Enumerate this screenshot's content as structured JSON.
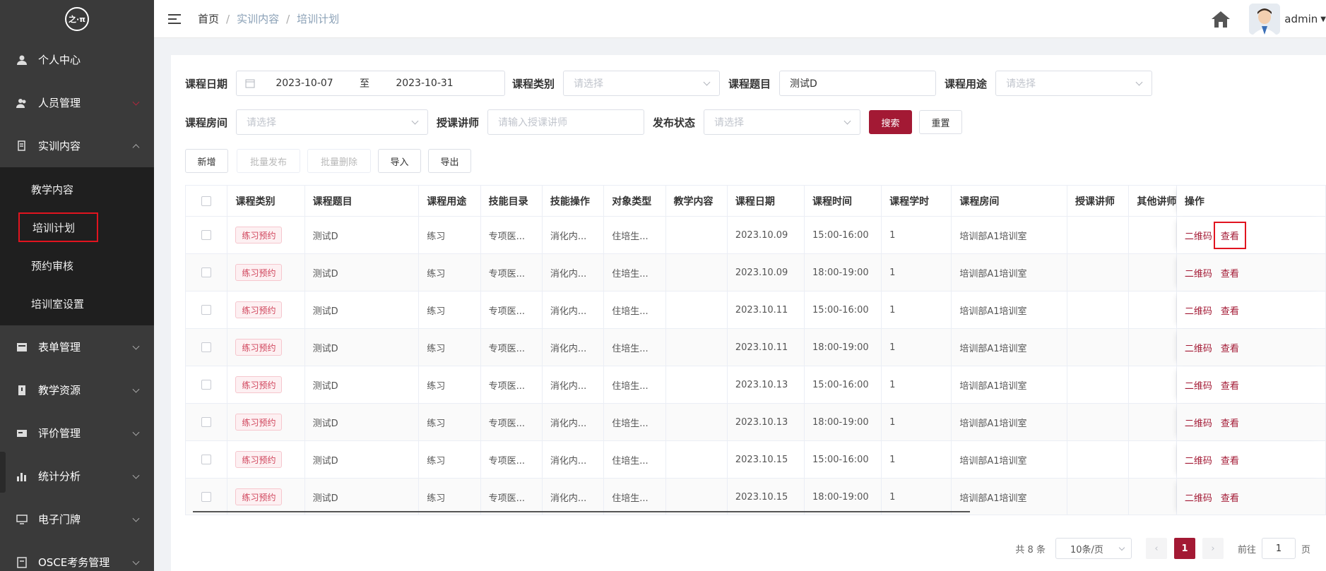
{
  "sidebar": {
    "logo_text": "之·π",
    "items": [
      {
        "label": "个人中心",
        "icon": "user-icon"
      },
      {
        "label": "人员管理",
        "icon": "users-icon"
      },
      {
        "label": "实训内容",
        "icon": "doc-icon"
      },
      {
        "label": "表单管理",
        "icon": "form-icon"
      },
      {
        "label": "教学资源",
        "icon": "book-icon"
      },
      {
        "label": "评价管理",
        "icon": "rating-icon"
      },
      {
        "label": "统计分析",
        "icon": "chart-icon"
      },
      {
        "label": "电子门牌",
        "icon": "monitor-icon"
      },
      {
        "label": "OSCE考务管理",
        "icon": "exam-icon"
      }
    ],
    "submenu": [
      "教学内容",
      "培训计划",
      "预约审核",
      "培训室设置"
    ]
  },
  "header": {
    "breadcrumb": [
      "首页",
      "实训内容",
      "培训计划"
    ],
    "sep": "/",
    "username": "admin"
  },
  "filters": {
    "date_label": "课程日期",
    "date_start": "2023-10-07",
    "date_to": "至",
    "date_end": "2023-10-31",
    "category_label": "课程类别",
    "category_placeholder": "请选择",
    "topic_label": "课程题目",
    "topic_value": "测试D",
    "usage_label": "课程用途",
    "usage_placeholder": "请选择",
    "room_label": "课程房间",
    "room_placeholder": "请选择",
    "teacher_label": "授课讲师",
    "teacher_placeholder": "请输入授课讲师",
    "status_label": "发布状态",
    "status_placeholder": "请选择",
    "search_btn": "搜索",
    "reset_btn": "重置"
  },
  "toolbar": {
    "add": "新增",
    "batch_publish": "批量发布",
    "batch_delete": "批量删除",
    "import": "导入",
    "export": "导出"
  },
  "table": {
    "headers": [
      "课程类别",
      "课程题目",
      "课程用途",
      "技能目录",
      "技能操作",
      "对象类型",
      "教学内容",
      "课程日期",
      "课程时间",
      "课程学时",
      "课程房间",
      "授课讲师",
      "其他讲师",
      "操作"
    ],
    "rows": [
      {
        "category": "练习预约",
        "topic": "测试D",
        "usage": "练习",
        "skill_dir": "专项医...",
        "skill_op": "消化内...",
        "target": "住培生...",
        "content": "",
        "date": "2023.10.09",
        "time": "15:00-16:00",
        "hours": "1",
        "room": "培训部A1培训室",
        "teacher": "",
        "other": ""
      },
      {
        "category": "练习预约",
        "topic": "测试D",
        "usage": "练习",
        "skill_dir": "专项医...",
        "skill_op": "消化内...",
        "target": "住培生...",
        "content": "",
        "date": "2023.10.09",
        "time": "18:00-19:00",
        "hours": "1",
        "room": "培训部A1培训室",
        "teacher": "",
        "other": ""
      },
      {
        "category": "练习预约",
        "topic": "测试D",
        "usage": "练习",
        "skill_dir": "专项医...",
        "skill_op": "消化内...",
        "target": "住培生...",
        "content": "",
        "date": "2023.10.11",
        "time": "15:00-16:00",
        "hours": "1",
        "room": "培训部A1培训室",
        "teacher": "",
        "other": ""
      },
      {
        "category": "练习预约",
        "topic": "测试D",
        "usage": "练习",
        "skill_dir": "专项医...",
        "skill_op": "消化内...",
        "target": "住培生...",
        "content": "",
        "date": "2023.10.11",
        "time": "18:00-19:00",
        "hours": "1",
        "room": "培训部A1培训室",
        "teacher": "",
        "other": ""
      },
      {
        "category": "练习预约",
        "topic": "测试D",
        "usage": "练习",
        "skill_dir": "专项医...",
        "skill_op": "消化内...",
        "target": "住培生...",
        "content": "",
        "date": "2023.10.13",
        "time": "15:00-16:00",
        "hours": "1",
        "room": "培训部A1培训室",
        "teacher": "",
        "other": ""
      },
      {
        "category": "练习预约",
        "topic": "测试D",
        "usage": "练习",
        "skill_dir": "专项医...",
        "skill_op": "消化内...",
        "target": "住培生...",
        "content": "",
        "date": "2023.10.13",
        "time": "18:00-19:00",
        "hours": "1",
        "room": "培训部A1培训室",
        "teacher": "",
        "other": ""
      },
      {
        "category": "练习预约",
        "topic": "测试D",
        "usage": "练习",
        "skill_dir": "专项医...",
        "skill_op": "消化内...",
        "target": "住培生...",
        "content": "",
        "date": "2023.10.15",
        "time": "15:00-16:00",
        "hours": "1",
        "room": "培训部A1培训室",
        "teacher": "",
        "other": ""
      },
      {
        "category": "练习预约",
        "topic": "测试D",
        "usage": "练习",
        "skill_dir": "专项医...",
        "skill_op": "消化内...",
        "target": "住培生...",
        "content": "",
        "date": "2023.10.15",
        "time": "18:00-19:00",
        "hours": "1",
        "room": "培训部A1培训室",
        "teacher": "",
        "other": ""
      }
    ],
    "op_qrcode": "二维码",
    "op_view": "查看"
  },
  "pagination": {
    "total": "共 8 条",
    "page_size": "10条/页",
    "current_page": "1",
    "goto_prefix": "前往",
    "goto_value": "1",
    "goto_suffix": "页"
  },
  "colors": {
    "accent": "#a31934",
    "sidebar_bg": "#3a3a3a",
    "highlight_box": "#e1141f"
  }
}
